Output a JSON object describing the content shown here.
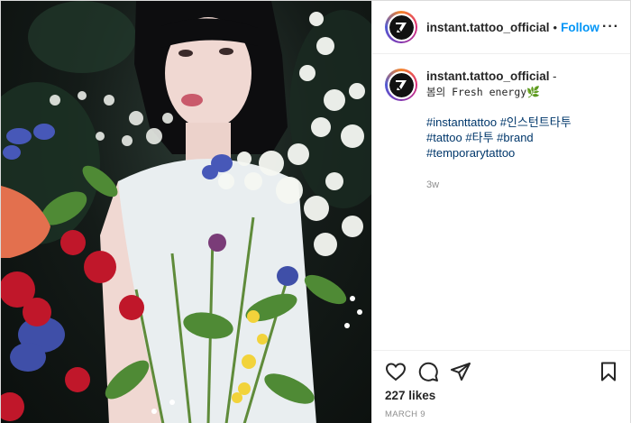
{
  "photo": {
    "alt": ""
  },
  "header": {
    "username": "instant.tattoo_official",
    "separator": "•",
    "follow_label": "Follow",
    "more_label": "···"
  },
  "caption": {
    "username": "instant.tattoo_official",
    "suffix": " -",
    "text": "봄의 Fresh energy",
    "emoji": "🌿",
    "hashtags_line1": [
      "#instanttattoo",
      "#인스턴트타투"
    ],
    "hashtags_line2": [
      "#tattoo",
      "#타투",
      "#brand",
      "#temporarytattoo"
    ],
    "age": "3w"
  },
  "actions": {
    "icons": [
      "heart-icon",
      "comment-icon",
      "share-icon",
      "bookmark-icon"
    ],
    "likes": "227 likes",
    "date": "MARCH 9"
  },
  "colors": {
    "follow": "#0095f6",
    "hashtag": "#00376b",
    "muted": "#8e8e8e",
    "border": "#efefef"
  }
}
